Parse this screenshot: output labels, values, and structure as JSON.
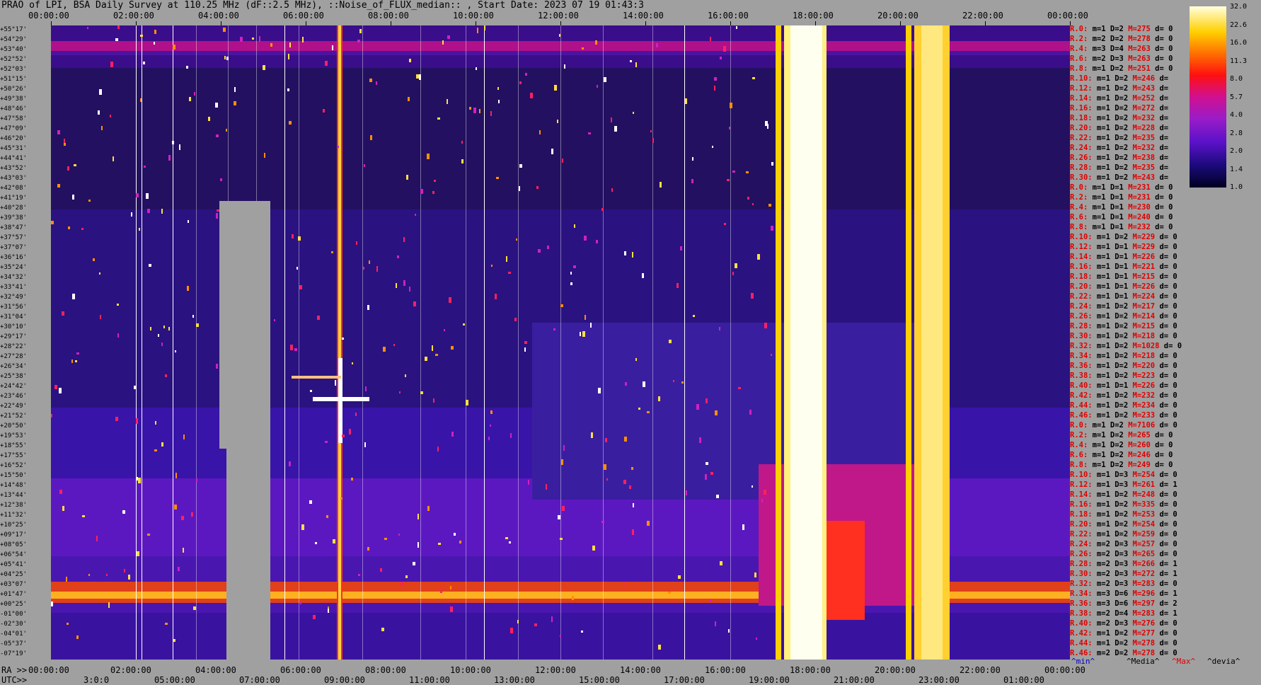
{
  "title": "PRAO of LPI, BSA Daily Survey at 110.25 MHz (dF::2.5 MHz), ::Noise_of_FLUX_median:: , Start Date: 2023 07 19 01:43:3",
  "top_time_labels": [
    "00:00:00",
    "02:00:00",
    "04:00:00",
    "06:00:00",
    "08:00:00",
    "10:00:00",
    "12:00:00",
    "14:00:00",
    "16:00:00",
    "18:00:00",
    "20:00:00",
    "22:00:00",
    "00:00:00"
  ],
  "bottom_ra_prefix": "RA >>",
  "bottom_ra_labels": [
    "00:00:00",
    "02:00:00",
    "04:00:00",
    "06:00:00",
    "08:00:00",
    "10:00:00",
    "12:00:00",
    "14:00:00",
    "16:00:00",
    "18:00:00",
    "20:00:00",
    "22:00:00",
    "00:00:00"
  ],
  "bottom_utc_prefix": "UTC>>",
  "bottom_utc_labels": [
    "3:0:0",
    "05:00:00",
    "07:00:00",
    "09:00:00",
    "11:00:00",
    "13:00:00",
    "15:00:00",
    "17:00:00",
    "19:00:00",
    "21:00:00",
    "23:00:00",
    "01:00:00"
  ],
  "dec_labels": [
    "+55°17'",
    "+54°29'",
    "+53°40'",
    "+52°52'",
    "+52°03'",
    "+51°15'",
    "+50°26'",
    "+49°38'",
    "+48°46'",
    "+47°58'",
    "+47°09'",
    "+46°20'",
    "+45°31'",
    "+44°41'",
    "+43°52'",
    "+43°03'",
    "+42°08'",
    "+41°19'",
    "+40°28'",
    "+39°38'",
    "+38°47'",
    "+37°57'",
    "+37°07'",
    "+36°16'",
    "+35°24'",
    "+34°32'",
    "+33°41'",
    "+32°49'",
    "+31°56'",
    "+31°04'",
    "+30°10'",
    "+29°17'",
    "+28°22'",
    "+27°28'",
    "+26°34'",
    "+25°38'",
    "+24°42'",
    "+23°46'",
    "+22°49'",
    "+21°52'",
    "+20°50'",
    "+19°53'",
    "+18°55'",
    "+17°55'",
    "+16°52'",
    "+15°50'",
    "+14°48'",
    "+13°44'",
    "+12°38'",
    "+11°32'",
    "+10°25'",
    "+09°17'",
    "+08°05'",
    "+06°54'",
    "+05°41'",
    "+04°25'",
    "+03°07'",
    "+01°47'",
    "+00°25'",
    "-01°00'",
    "-02°30'",
    "-04°01'",
    "-05°37'",
    "-07°19'"
  ],
  "row_stats": [
    [
      "R.0:",
      "m=1",
      "D=2",
      "M=275",
      "d= 0"
    ],
    [
      "R.2:",
      "m=2",
      "D=2",
      "M=278",
      "d= 0"
    ],
    [
      "R.4:",
      "m=3",
      "D=4",
      "M=263",
      "d= 0"
    ],
    [
      "R.6:",
      "m=2",
      "D=3",
      "M=263",
      "d= 0"
    ],
    [
      "R.8:",
      "m=1",
      "D=2",
      "M=251",
      "d= 0"
    ],
    [
      "R.10:",
      "m=1",
      "D=2",
      "M=246",
      "d="
    ],
    [
      "R.12:",
      "m=1",
      "D=2",
      "M=243",
      "d="
    ],
    [
      "R.14:",
      "m=1",
      "D=2",
      "M=252",
      "d="
    ],
    [
      "R.16:",
      "m=1",
      "D=2",
      "M=272",
      "d="
    ],
    [
      "R.18:",
      "m=1",
      "D=2",
      "M=232",
      "d="
    ],
    [
      "R.20:",
      "m=1",
      "D=2",
      "M=228",
      "d="
    ],
    [
      "R.22:",
      "m=1",
      "D=2",
      "M=235",
      "d="
    ],
    [
      "R.24:",
      "m=1",
      "D=2",
      "M=232",
      "d="
    ],
    [
      "R.26:",
      "m=1",
      "D=2",
      "M=238",
      "d="
    ],
    [
      "R.28:",
      "m=1",
      "D=2",
      "M=235",
      "d="
    ],
    [
      "R.30:",
      "m=1",
      "D=2",
      "M=243",
      "d="
    ],
    [
      "R.0:",
      "m=1",
      "D=1",
      "M=231",
      "d= 0"
    ],
    [
      "R.2:",
      "m=1",
      "D=1",
      "M=231",
      "d= 0"
    ],
    [
      "R.4:",
      "m=1",
      "D=1",
      "M=230",
      "d= 0"
    ],
    [
      "R.6:",
      "m=1",
      "D=1",
      "M=240",
      "d= 0"
    ],
    [
      "R.8:",
      "m=1",
      "D=1",
      "M=232",
      "d= 0"
    ],
    [
      "R.10:",
      "m=1",
      "D=2",
      "M=229",
      "d= 0"
    ],
    [
      "R.12:",
      "m=1",
      "D=1",
      "M=229",
      "d= 0"
    ],
    [
      "R.14:",
      "m=1",
      "D=1",
      "M=226",
      "d= 0"
    ],
    [
      "R.16:",
      "m=1",
      "D=1",
      "M=221",
      "d= 0"
    ],
    [
      "R.18:",
      "m=1",
      "D=1",
      "M=215",
      "d= 0"
    ],
    [
      "R.20:",
      "m=1",
      "D=1",
      "M=226",
      "d= 0"
    ],
    [
      "R.22:",
      "m=1",
      "D=1",
      "M=224",
      "d= 0"
    ],
    [
      "R.24:",
      "m=1",
      "D=2",
      "M=217",
      "d= 0"
    ],
    [
      "R.26:",
      "m=1",
      "D=2",
      "M=214",
      "d= 0"
    ],
    [
      "R.28:",
      "m=1",
      "D=2",
      "M=215",
      "d= 0"
    ],
    [
      "R.30:",
      "m=1",
      "D=2",
      "M=218",
      "d= 0"
    ],
    [
      "R.32:",
      "m=1",
      "D=2",
      "M=1028",
      "d= 0"
    ],
    [
      "R.34:",
      "m=1",
      "D=2",
      "M=218",
      "d= 0"
    ],
    [
      "R.36:",
      "m=1",
      "D=2",
      "M=220",
      "d= 0"
    ],
    [
      "R.38:",
      "m=1",
      "D=2",
      "M=223",
      "d= 0"
    ],
    [
      "R.40:",
      "m=1",
      "D=1",
      "M=226",
      "d= 0"
    ],
    [
      "R.42:",
      "m=1",
      "D=2",
      "M=232",
      "d= 0"
    ],
    [
      "R.44:",
      "m=1",
      "D=2",
      "M=234",
      "d= 0"
    ],
    [
      "R.46:",
      "m=1",
      "D=2",
      "M=233",
      "d= 0"
    ],
    [
      "R.0:",
      "m=1",
      "D=2",
      "M=7106",
      "d= 0"
    ],
    [
      "R.2:",
      "m=1",
      "D=2",
      "M=265",
      "d= 0"
    ],
    [
      "R.4:",
      "m=1",
      "D=2",
      "M=260",
      "d= 0"
    ],
    [
      "R.6:",
      "m=1",
      "D=2",
      "M=246",
      "d= 0"
    ],
    [
      "R.8:",
      "m=1",
      "D=2",
      "M=249",
      "d= 0"
    ],
    [
      "R.10:",
      "m=1",
      "D=3",
      "M=254",
      "d= 0"
    ],
    [
      "R.12:",
      "m=1",
      "D=3",
      "M=261",
      "d= 1"
    ],
    [
      "R.14:",
      "m=1",
      "D=2",
      "M=248",
      "d= 0"
    ],
    [
      "R.16:",
      "m=1",
      "D=2",
      "M=335",
      "d= 0"
    ],
    [
      "R.18:",
      "m=1",
      "D=2",
      "M=253",
      "d= 0"
    ],
    [
      "R.20:",
      "m=1",
      "D=2",
      "M=254",
      "d= 0"
    ],
    [
      "R.22:",
      "m=1",
      "D=2",
      "M=259",
      "d= 0"
    ],
    [
      "R.24:",
      "m=2",
      "D=3",
      "M=257",
      "d= 0"
    ],
    [
      "R.26:",
      "m=2",
      "D=3",
      "M=265",
      "d= 0"
    ],
    [
      "R.28:",
      "m=2",
      "D=3",
      "M=266",
      "d= 1"
    ],
    [
      "R.30:",
      "m=2",
      "D=3",
      "M=272",
      "d= 1"
    ],
    [
      "R.32:",
      "m=2",
      "D=3",
      "M=283",
      "d= 0"
    ],
    [
      "R.34:",
      "m=3",
      "D=6",
      "M=296",
      "d= 1"
    ],
    [
      "R.36:",
      "m=3",
      "D=6",
      "M=297",
      "d= 2"
    ],
    [
      "R.38:",
      "m=2",
      "D=4",
      "M=283",
      "d= 1"
    ],
    [
      "R.40:",
      "m=2",
      "D=3",
      "M=276",
      "d= 0"
    ],
    [
      "R.42:",
      "m=1",
      "D=2",
      "M=277",
      "d= 0"
    ],
    [
      "R.44:",
      "m=1",
      "D=2",
      "M=278",
      "d= 0"
    ],
    [
      "R.46:",
      "m=2",
      "D=2",
      "M=278",
      "d= 0"
    ]
  ],
  "colorbar_ticks": [
    "32.0",
    "22.6",
    "16.0",
    "11.3",
    "8.0",
    "5.7",
    "4.0",
    "2.8",
    "2.0",
    "1.4",
    "1.0"
  ],
  "legend": {
    "min": "^min^",
    "media": "^Media^",
    "max": "^Max^",
    "devia": "^devia^"
  },
  "colors": {
    "min": "#0000c0",
    "media": "#000000",
    "max": "#e00000",
    "devia": "#000000"
  }
}
